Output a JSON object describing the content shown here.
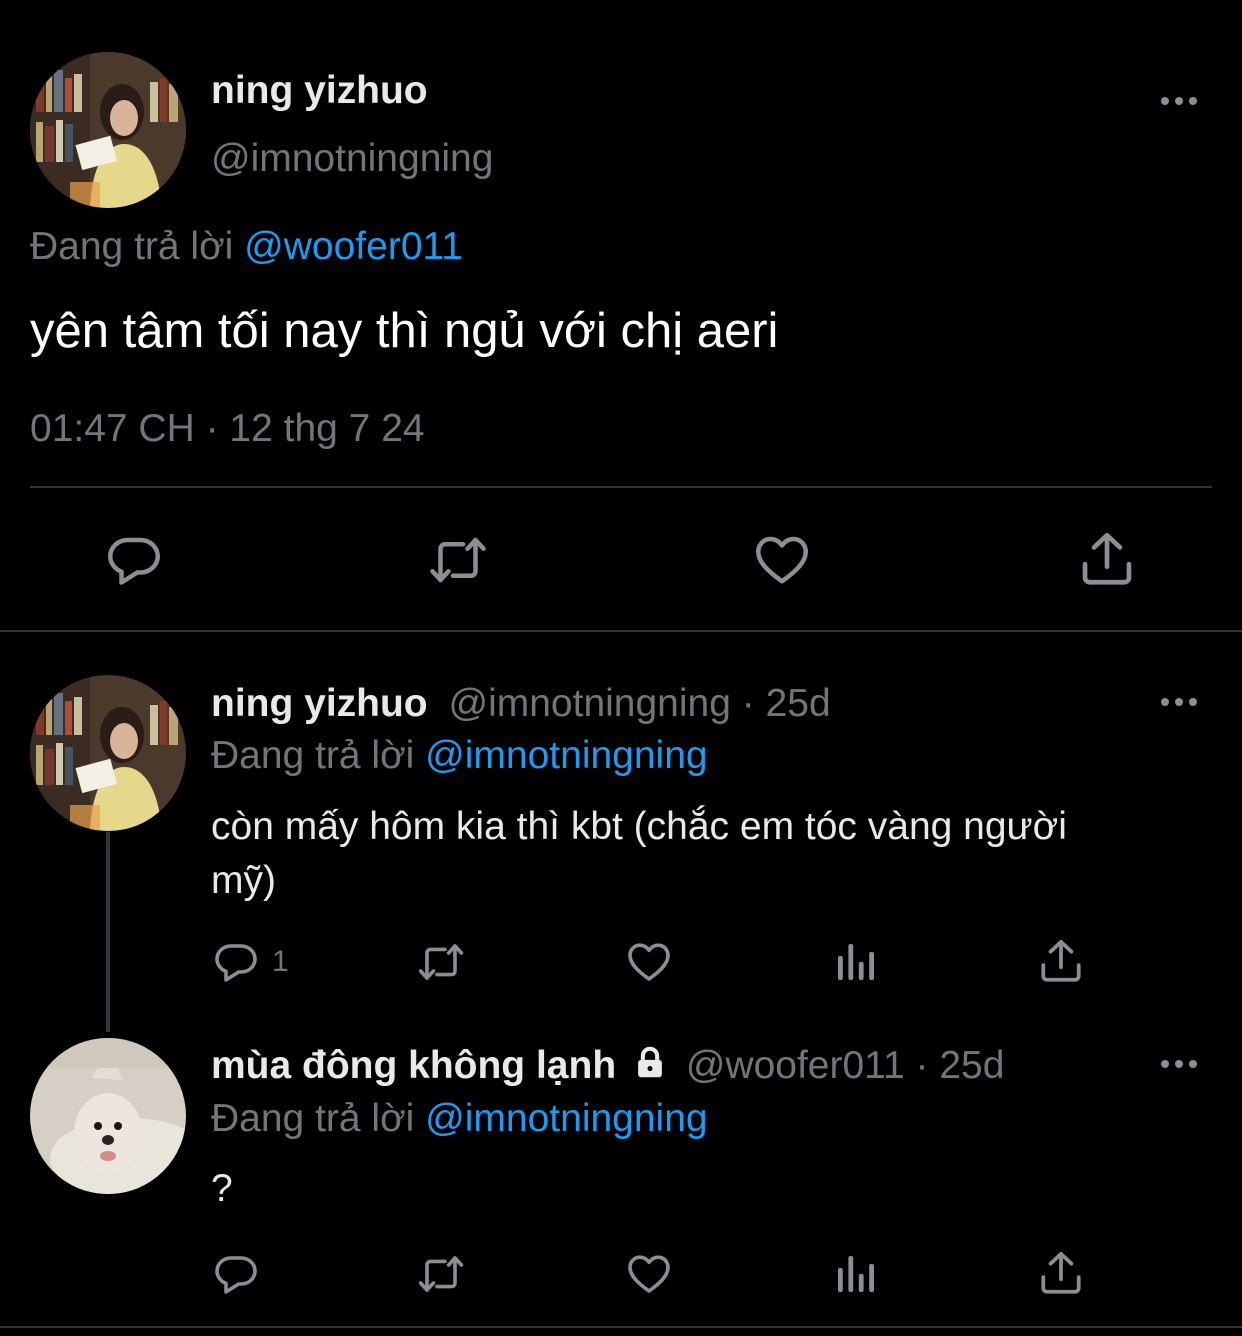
{
  "main_tweet": {
    "name": "ning yizhuo",
    "handle": "@imnotningning",
    "replying_label": "Đang trả lời",
    "replying_to": "@woofer011",
    "text": "yên tâm tối nay thì ngủ với chị aeri",
    "timestamp": "01:47 CH · 12 thg 7 24",
    "actions": [
      "reply-icon",
      "retweet-icon",
      "like-icon",
      "share-icon"
    ]
  },
  "replies": [
    {
      "name": "ning yizhuo",
      "handle": "@imnotningning",
      "time": "· 25d",
      "replying_label": "Đang trả lời",
      "replying_to": "@imnotningning",
      "text": "còn mấy hôm kia thì kbt (chắc em tóc vàng người mỹ)",
      "reply_count": "1",
      "actions": [
        "reply-icon",
        "retweet-icon",
        "like-icon",
        "analytics-icon",
        "share-icon"
      ]
    },
    {
      "name": "mùa đông không lạnh",
      "locked": true,
      "handle": "@woofer011",
      "time": "· 25d",
      "replying_label": "Đang trả lời",
      "replying_to": "@imnotningning",
      "text": "?",
      "actions": [
        "reply-icon",
        "retweet-icon",
        "like-icon",
        "analytics-icon",
        "share-icon"
      ]
    }
  ],
  "colors": {
    "background": "#000000",
    "text": "#e7e9ea",
    "muted": "#71767b",
    "link": "#1d9bf0",
    "divider": "#2f3336"
  }
}
